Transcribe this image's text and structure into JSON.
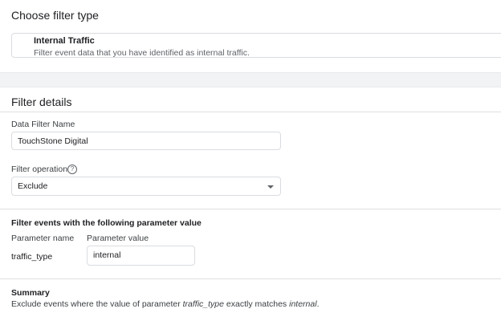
{
  "filter_type": {
    "heading": "Choose filter type",
    "option": {
      "title": "Internal Traffic",
      "description": "Filter event data that you have identified as internal traffic."
    }
  },
  "filter_details": {
    "heading": "Filter details",
    "name_label": "Data Filter Name",
    "name_value": "TouchStone Digital",
    "operation_label": "Filter operation",
    "operation_help_glyph": "?",
    "operation_value": "Exclude"
  },
  "parameter_section": {
    "heading": "Filter events with the following parameter value",
    "col_name": "Parameter name",
    "col_value": "Parameter value",
    "param_name": "traffic_type",
    "param_value": "internal"
  },
  "summary": {
    "heading": "Summary",
    "text_prefix": "Exclude events where the value of parameter ",
    "param": "traffic_type",
    "text_middle": " exactly matches ",
    "value": "internal",
    "text_suffix": "."
  }
}
